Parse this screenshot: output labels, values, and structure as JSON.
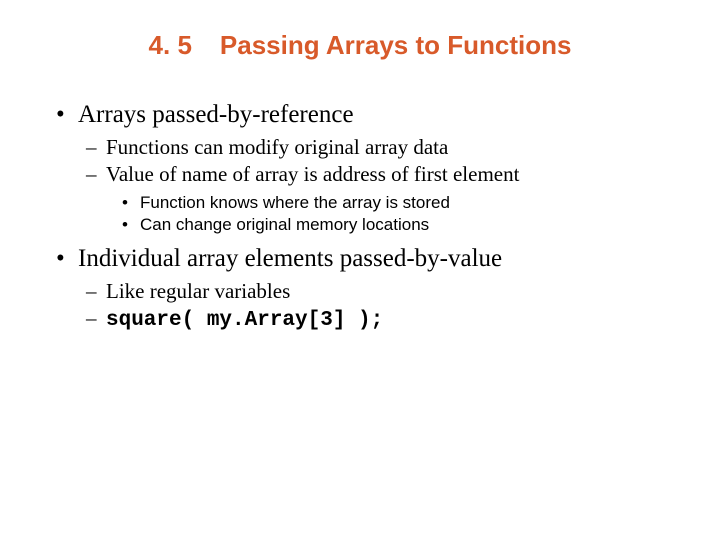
{
  "title": {
    "number": "4. 5",
    "text": "Passing Arrays to Functions"
  },
  "bullets": {
    "b1": "Arrays passed-by-reference",
    "b1_1": "Functions can modify original array data",
    "b1_2": "Value of name of array is address of first element",
    "b1_2_1": "Function knows where the array is stored",
    "b1_2_2": "Can change original memory locations",
    "b2": "Individual array elements passed-by-value",
    "b2_1": "Like regular variables",
    "b2_2": "square( my.Array[3] );"
  }
}
